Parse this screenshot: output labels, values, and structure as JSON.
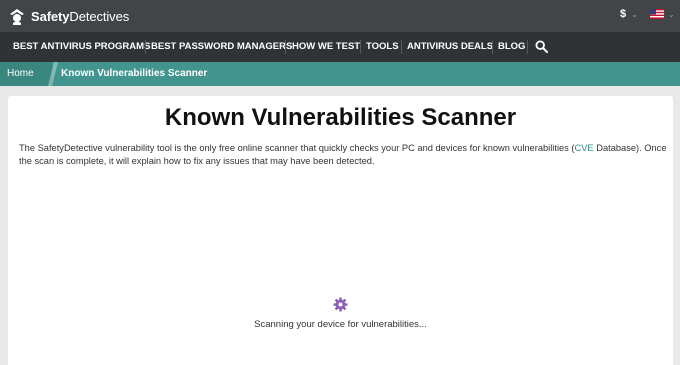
{
  "header": {
    "logo_bold": "Safety",
    "logo_rest": "Detectives",
    "currency": "$",
    "language_icon": "us-flag-icon",
    "chevron_icon": "chevron-down-icon"
  },
  "nav": {
    "items": [
      "BEST ANTIVIRUS PROGRAMS",
      "BEST PASSWORD MANAGERS",
      "HOW WE TEST",
      "TOOLS",
      "ANTIVIRUS DEALS",
      "BLOG"
    ],
    "search_icon": "search-icon"
  },
  "breadcrumb": {
    "home": "Home",
    "current": "Known Vulnerabilities Scanner"
  },
  "main": {
    "title": "Known Vulnerabilities Scanner",
    "desc_part1": "The SafetyDetective vulnerability tool is the only free online scanner that quickly checks your PC and devices for known vulnerabilities (",
    "desc_link": "CVE",
    "desc_part2": " Database). Once the scan is complete, it will explain how to fix any issues that may have been detected.",
    "spinner_icon": "gear-icon",
    "status": "Scanning your device for vulnerabilities..."
  },
  "colors": {
    "topbar": "#414548",
    "navbar": "#2f3336",
    "breadcrumb": "#41958e",
    "link": "#2f8c84",
    "spinner": "#8e63b5"
  }
}
